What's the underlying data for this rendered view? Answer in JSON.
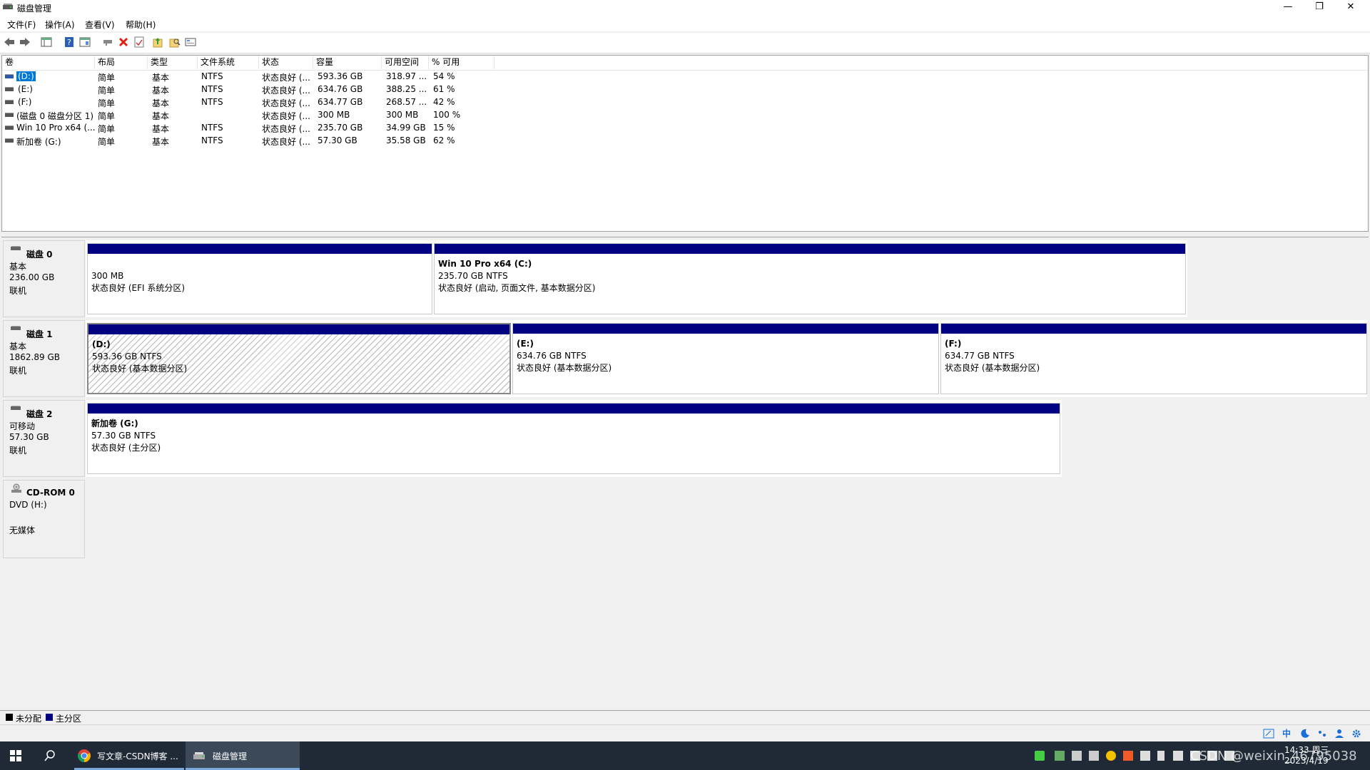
{
  "window": {
    "title": "磁盘管理",
    "minimize_glyph": "—",
    "maximize_glyph": "❐",
    "close_glyph": "✕"
  },
  "menu": [
    "文件(F)",
    "操作(A)",
    "查看(V)",
    "帮助(H)"
  ],
  "toolbar": [
    "back-icon",
    "forward-icon",
    "console-tree-icon",
    "help-icon",
    "show-pane-icon",
    "connect-icon",
    "delete-icon",
    "properties-icon",
    "export-icon",
    "search-icon",
    "refresh-icon"
  ],
  "list": {
    "headers": [
      "卷",
      "布局",
      "类型",
      "文件系统",
      "状态",
      "容量",
      "可用空间",
      "% 可用"
    ],
    "rows": [
      {
        "vol": "(D:)",
        "layout": "简单",
        "type": "基本",
        "fs": "NTFS",
        "status": "状态良好 (...",
        "capacity": "593.36 GB",
        "free": "318.97 ...",
        "pct": "54 %",
        "selected": true
      },
      {
        "vol": "(E:)",
        "layout": "简单",
        "type": "基本",
        "fs": "NTFS",
        "status": "状态良好 (...",
        "capacity": "634.76 GB",
        "free": "388.25 ...",
        "pct": "61 %"
      },
      {
        "vol": "(F:)",
        "layout": "简单",
        "type": "基本",
        "fs": "NTFS",
        "status": "状态良好 (...",
        "capacity": "634.77 GB",
        "free": "268.57 ...",
        "pct": "42 %"
      },
      {
        "vol": "(磁盘 0 磁盘分区 1)",
        "layout": "简单",
        "type": "基本",
        "fs": "",
        "status": "状态良好 (...",
        "capacity": "300 MB",
        "free": "300 MB",
        "pct": "100 %"
      },
      {
        "vol": "Win 10 Pro x64 (...",
        "layout": "简单",
        "type": "基本",
        "fs": "NTFS",
        "status": "状态良好 (...",
        "capacity": "235.70 GB",
        "free": "34.99 GB",
        "pct": "15 %"
      },
      {
        "vol": "新加卷 (G:)",
        "layout": "简单",
        "type": "基本",
        "fs": "NTFS",
        "status": "状态良好 (...",
        "capacity": "57.30 GB",
        "free": "35.58 GB",
        "pct": "62 %"
      }
    ]
  },
  "disks": [
    {
      "name": "磁盘 0",
      "kind": "基本",
      "size": "236.00 GB",
      "state": "联机",
      "partitions": [
        {
          "label": "",
          "size": "300 MB",
          "status": "状态良好 (EFI 系统分区)"
        },
        {
          "label": "Win 10 Pro x64  (C:)",
          "size": "235.70 GB NTFS",
          "status": "状态良好 (启动, 页面文件, 基本数据分区)"
        }
      ]
    },
    {
      "name": "磁盘 1",
      "kind": "基本",
      "size": "1862.89 GB",
      "state": "联机",
      "partitions": [
        {
          "label": "(D:)",
          "size": "593.36 GB NTFS",
          "status": "状态良好 (基本数据分区)"
        },
        {
          "label": "(E:)",
          "size": "634.76 GB NTFS",
          "status": "状态良好 (基本数据分区)"
        },
        {
          "label": "(F:)",
          "size": "634.77 GB NTFS",
          "status": "状态良好 (基本数据分区)"
        }
      ]
    },
    {
      "name": "磁盘 2",
      "kind": "可移动",
      "size": "57.30 GB",
      "state": "联机",
      "partitions": [
        {
          "label": "新加卷  (G:)",
          "size": "57.30 GB NTFS",
          "status": "状态良好 (主分区)"
        }
      ]
    },
    {
      "name": "CD-ROM 0",
      "kind": "DVD (H:)",
      "size": "",
      "state": "无媒体",
      "partitions": []
    }
  ],
  "legend": [
    {
      "label": "未分配",
      "color": "#000000"
    },
    {
      "label": "主分区",
      "color": "#000080"
    }
  ],
  "taskbar": {
    "apps": [
      {
        "label": "写文章-CSDN博客 ..."
      },
      {
        "label": "磁盘管理"
      }
    ],
    "tray_lang": "中",
    "time": "14:33 周三",
    "date": "2023/4/19",
    "watermark": "CSDN @weixin_46795038"
  },
  "colors": {
    "primary_partition": "#000080",
    "selection": "#0078d7",
    "taskbar": "#1f2a36"
  }
}
